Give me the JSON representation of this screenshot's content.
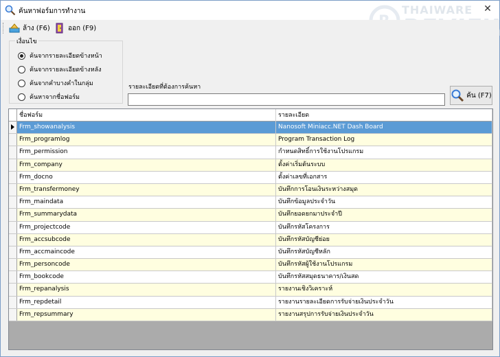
{
  "window": {
    "title": "ค้นหาฟอร์มการทำงาน",
    "close_glyph": "✕"
  },
  "toolbar": {
    "clear_label": "ล้าง (F6)",
    "exit_label": "ออก (F9)"
  },
  "conditions": {
    "title": "เงื่อนไข",
    "options": [
      {
        "label": "ค้นจากรายละเอียดข้างหน้า",
        "selected": true
      },
      {
        "label": "ค้นจากรายละเอียดข้างหลัง",
        "selected": false
      },
      {
        "label": "ค้นจากคำบางคำในกลุ่ม",
        "selected": false
      },
      {
        "label": "ค้นหาจากชื่อฟอร์ม",
        "selected": false
      }
    ]
  },
  "search": {
    "label": "รายละเอียดที่ต้องการค้นหา",
    "value": "",
    "button_label": "ค้น (F7)"
  },
  "grid": {
    "columns": [
      "ชื่อฟอร์ม",
      "รายละเอียด"
    ],
    "rows": [
      [
        "Frm_showanalysis",
        "Nanosoft Miniacc.NET Dash Board"
      ],
      [
        "Frm_programlog",
        "Program Transaction Log"
      ],
      [
        "Frm_permission",
        "กำหนดสิทธิ์การใช้งานโปรแกรม"
      ],
      [
        "Frm_company",
        "ตั้งค่าเริ่มต้นระบบ"
      ],
      [
        "Frm_docno",
        "ตั้งค่าเลขที่เอกสาร"
      ],
      [
        "Frm_transfermoney",
        "บันทึกการโอนเงินระหว่างสมุด"
      ],
      [
        "Frm_maindata",
        "บันทึกข้อมูลประจำวัน"
      ],
      [
        "Frm_summarydata",
        "บันทึกยอดยกมาประจำปี"
      ],
      [
        "Frm_projectcode",
        "บันทึกรหัสโครงการ"
      ],
      [
        "Frm_accsubcode",
        "บันทึกรหัสบัญชีย่อย"
      ],
      [
        "Frm_accmaincode",
        "บันทึกรหัสบัญชีหลัก"
      ],
      [
        "Frm_personcode",
        "บันทึกรหัสผู้ใช้งานโปรแกรม"
      ],
      [
        "Frm_bookcode",
        "บันทึกรหัสสมุดธนาคาร/เงินสด"
      ],
      [
        "Frm_repanalysis",
        "รายงานเชิงวิเคราะห์"
      ],
      [
        "Frm_repdetail",
        "รายงานรายละเอียดการรับจ่ายเงินประจำวัน"
      ],
      [
        "Frm_repsummary",
        "รายงานสรุปการรับจ่ายเงินประจำวัน"
      ]
    ],
    "selected_index": 0
  },
  "watermark": {
    "line1": "THAIWARE",
    "line2": "REVIEW"
  },
  "icons": {
    "title": "magnifier-icon",
    "clear": "eraser-icon",
    "exit": "exit-door-icon",
    "search": "magnifier-icon"
  }
}
